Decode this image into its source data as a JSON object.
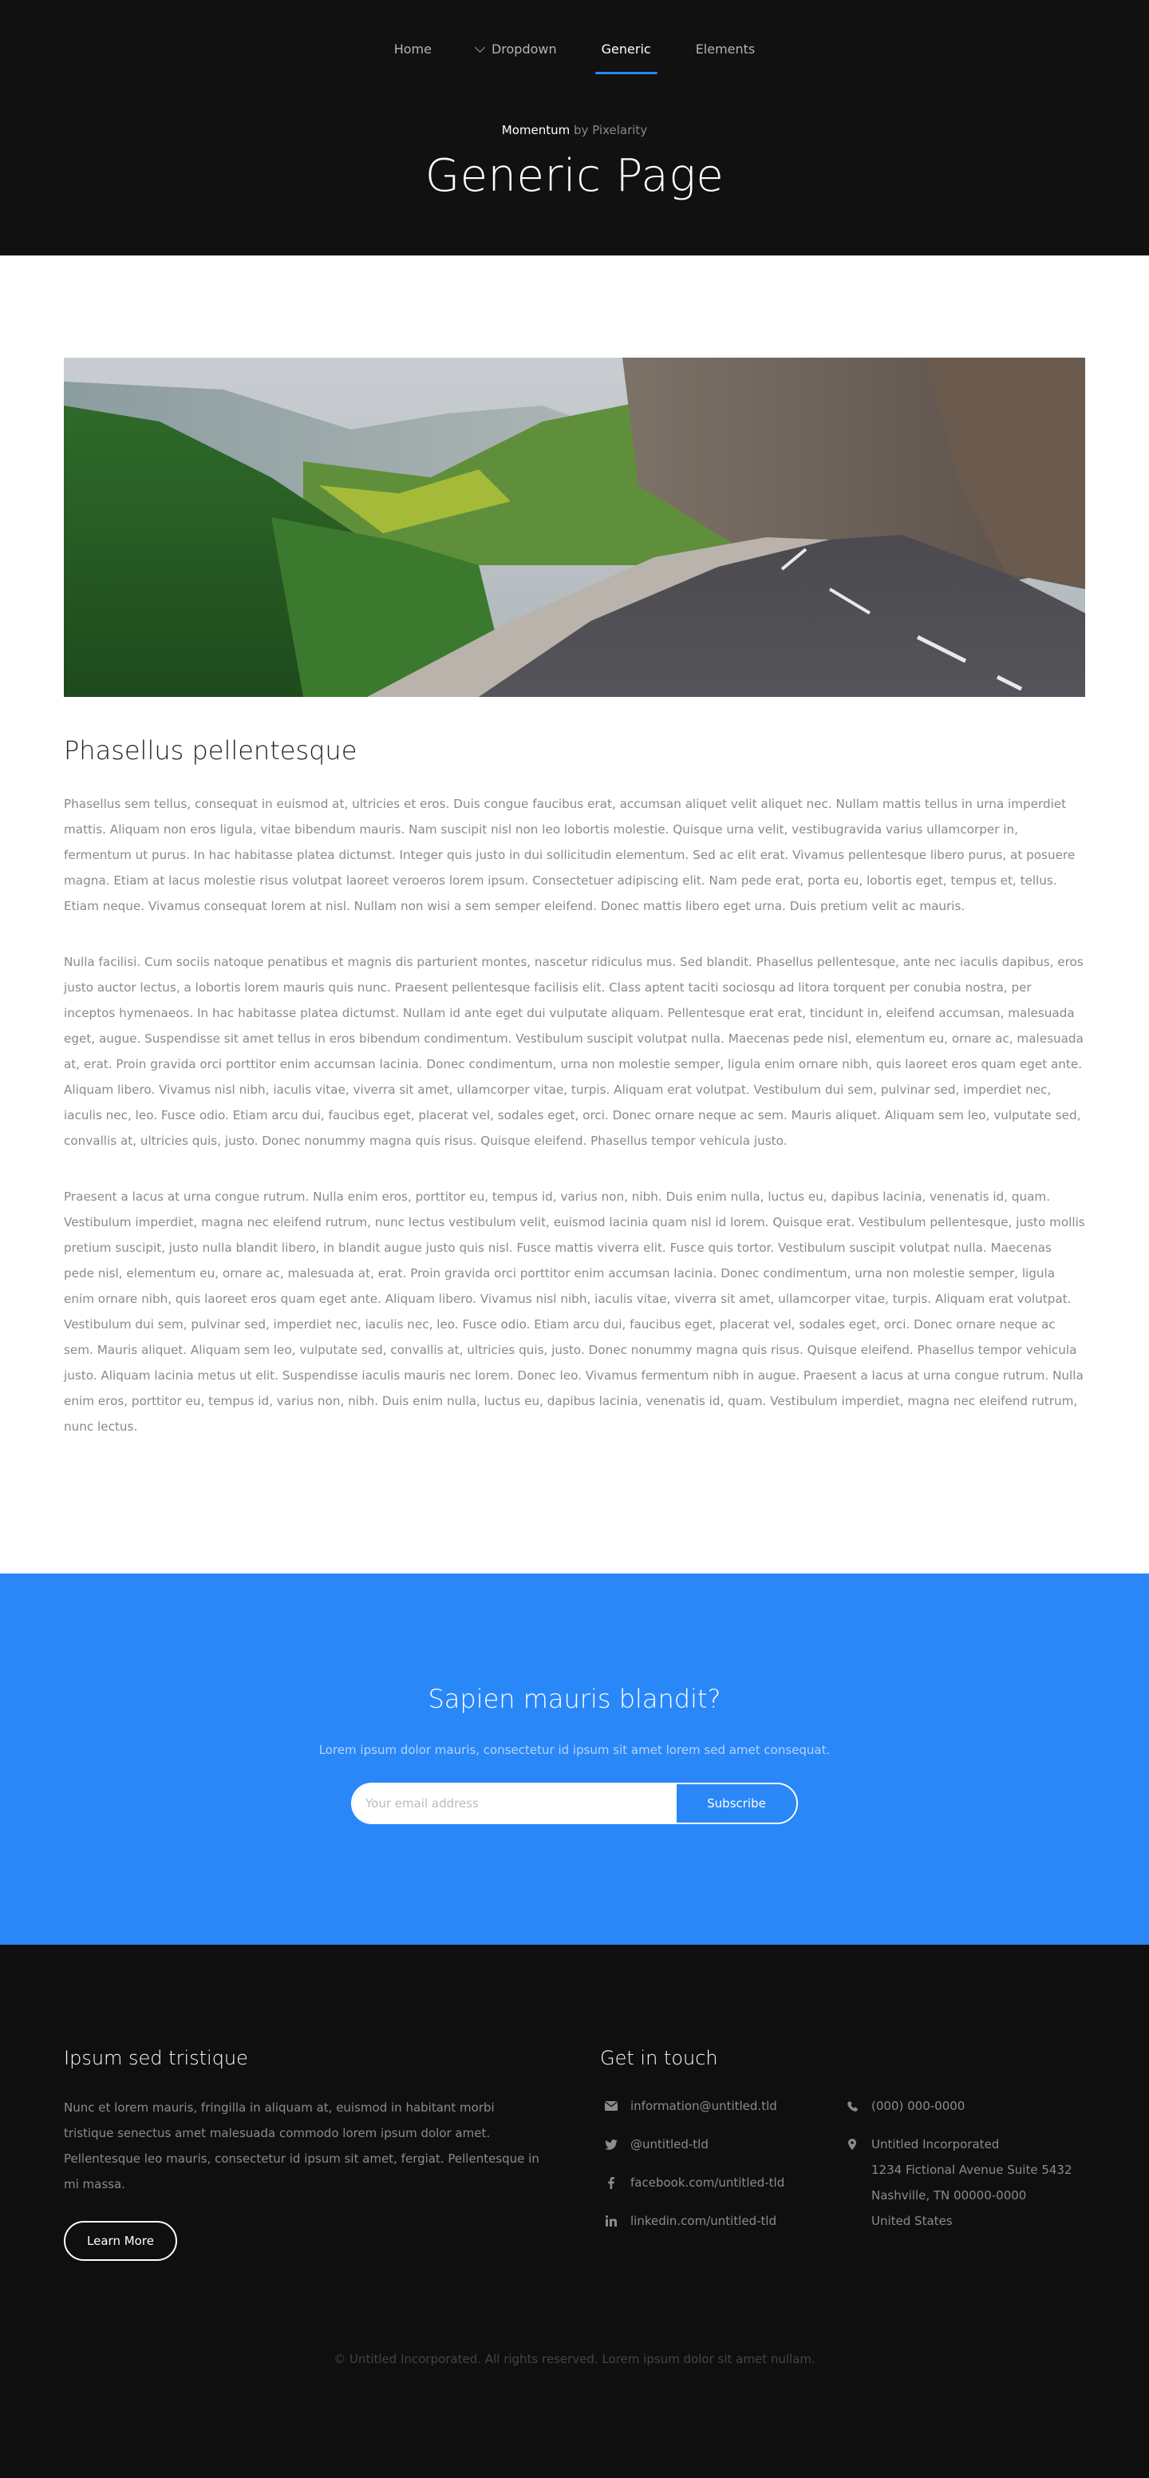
{
  "nav": {
    "items": [
      {
        "label": "Home"
      },
      {
        "label": "Dropdown"
      },
      {
        "label": "Generic"
      },
      {
        "label": "Elements"
      }
    ]
  },
  "header": {
    "brand_name": "Momentum",
    "brand_by": "by Pixelarity",
    "title": "Generic Page"
  },
  "main": {
    "image_alt": "mountain-road-photo",
    "heading": "Phasellus pellentesque",
    "paragraphs": [
      "Phasellus sem tellus, consequat in euismod at, ultricies et eros. Duis congue faucibus erat, accumsan aliquet velit aliquet nec. Nullam mattis tellus in urna imperdiet mattis. Aliquam non eros ligula, vitae bibendum mauris. Nam suscipit nisl non leo lobortis molestie. Quisque urna velit, vestibugravida varius ullamcorper in, fermentum ut purus. In hac habitasse platea dictumst. Integer quis justo in dui sollicitudin elementum. Sed ac elit erat. Vivamus pellentesque libero purus, at posuere magna. Etiam at lacus molestie risus volutpat laoreet veroeros lorem ipsum. Consectetuer adipiscing elit. Nam pede erat, porta eu, lobortis eget, tempus et, tellus. Etiam neque. Vivamus consequat lorem at nisl. Nullam non wisi a sem semper eleifend. Donec mattis libero eget urna. Duis pretium velit ac mauris.",
      "Nulla facilisi. Cum sociis natoque penatibus et magnis dis parturient montes, nascetur ridiculus mus. Sed blandit. Phasellus pellentesque, ante nec iaculis dapibus, eros justo auctor lectus, a lobortis lorem mauris quis nunc. Praesent pellentesque facilisis elit. Class aptent taciti sociosqu ad litora torquent per conubia nostra, per inceptos hymenaeos. In hac habitasse platea dictumst. Nullam id ante eget dui vulputate aliquam. Pellentesque erat erat, tincidunt in, eleifend accumsan, malesuada eget, augue. Suspendisse sit amet tellus in eros bibendum condimentum. Vestibulum suscipit volutpat nulla. Maecenas pede nisl, elementum eu, ornare ac, malesuada at, erat. Proin gravida orci porttitor enim accumsan lacinia. Donec condimentum, urna non molestie semper, ligula enim ornare nibh, quis laoreet eros quam eget ante. Aliquam libero. Vivamus nisl nibh, iaculis vitae, viverra sit amet, ullamcorper vitae, turpis. Aliquam erat volutpat. Vestibulum dui sem, pulvinar sed, imperdiet nec, iaculis nec, leo. Fusce odio. Etiam arcu dui, faucibus eget, placerat vel, sodales eget, orci. Donec ornare neque ac sem. Mauris aliquet. Aliquam sem leo, vulputate sed, convallis at, ultricies quis, justo. Donec nonummy magna quis risus. Quisque eleifend. Phasellus tempor vehicula justo.",
      "Praesent a lacus at urna congue rutrum. Nulla enim eros, porttitor eu, tempus id, varius non, nibh. Duis enim nulla, luctus eu, dapibus lacinia, venenatis id, quam. Vestibulum imperdiet, magna nec eleifend rutrum, nunc lectus vestibulum velit, euismod lacinia quam nisl id lorem. Quisque erat. Vestibulum pellentesque, justo mollis pretium suscipit, justo nulla blandit libero, in blandit augue justo quis nisl. Fusce mattis viverra elit. Fusce quis tortor. Vestibulum suscipit volutpat nulla. Maecenas pede nisl, elementum eu, ornare ac, malesuada at, erat. Proin gravida orci porttitor enim accumsan lacinia. Donec condimentum, urna non molestie semper, ligula enim ornare nibh, quis laoreet eros quam eget ante. Aliquam libero. Vivamus nisl nibh, iaculis vitae, viverra sit amet, ullamcorper vitae, turpis. Aliquam erat volutpat. Vestibulum dui sem, pulvinar sed, imperdiet nec, iaculis nec, leo. Fusce odio. Etiam arcu dui, faucibus eget, placerat vel, sodales eget, orci. Donec ornare neque ac sem. Mauris aliquet. Aliquam sem leo, vulputate sed, convallis at, ultricies quis, justo. Donec nonummy magna quis risus. Quisque eleifend. Phasellus tempor vehicula justo. Aliquam lacinia metus ut elit. Suspendisse iaculis mauris nec lorem. Donec leo. Vivamus fermentum nibh in augue. Praesent a lacus at urna congue rutrum. Nulla enim eros, porttitor eu, tempus id, varius non, nibh. Duis enim nulla, luctus eu, dapibus lacinia, venenatis id, quam. Vestibulum imperdiet, magna nec eleifend rutrum, nunc lectus."
    ]
  },
  "cta": {
    "title": "Sapien mauris blandit?",
    "subtitle": "Lorem ipsum dolor mauris, consectetur id ipsum sit amet lorem sed amet consequat.",
    "email_placeholder": "Your email address",
    "subscribe_label": "Subscribe"
  },
  "footer": {
    "left_title": "Ipsum sed tristique",
    "left_text": "Nunc et lorem mauris, fringilla in aliquam at, euismod in habitant morbi tristique senectus amet malesuada commodo lorem ipsum dolor amet. Pellentesque leo mauris, consectetur id ipsum sit amet, fergiat. Pellentesque in mi massa.",
    "learn_more": "Learn More",
    "right_title": "Get in touch",
    "contacts": [
      {
        "icon": "envelope-icon",
        "text": "information@untitled.tld"
      },
      {
        "icon": "twitter-icon",
        "text": "@untitled-tld"
      },
      {
        "icon": "facebook-icon",
        "text": "facebook.com/untitled-tld"
      },
      {
        "icon": "linkedin-icon",
        "text": "linkedin.com/untitled-tld"
      }
    ],
    "phone": {
      "icon": "phone-icon",
      "text": "(000) 000-0000"
    },
    "address": {
      "icon": "map-marker-icon",
      "lines": [
        "Untitled Incorporated",
        "1234 Fictional Avenue Suite 5432",
        "Nashville, TN 00000-0000",
        "United States"
      ]
    },
    "copyright": "© Untitled Incorporated. All rights reserved. Lorem ipsum dolor sit amet nullam."
  },
  "colors": {
    "header_bg": "#111111",
    "accent": "#2a87f8",
    "footer_bg": "#0f0f0f"
  }
}
